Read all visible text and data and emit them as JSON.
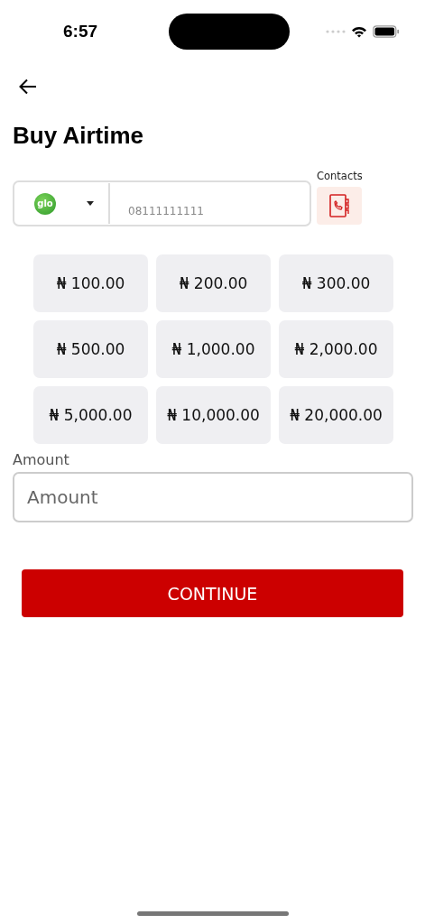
{
  "status_bar": {
    "time": "6:57"
  },
  "title": "Buy Airtime",
  "phone": {
    "network_logo": "glo",
    "placeholder": "08111111111",
    "contacts_label": "Contacts"
  },
  "amount_options": [
    "₦ 100.00",
    "₦ 200.00",
    "₦ 300.00",
    "₦ 500.00",
    "₦ 1,000.00",
    "₦ 2,000.00",
    "₦ 5,000.00",
    "₦ 10,000.00",
    "₦ 20,000.00"
  ],
  "amount": {
    "label": "Amount",
    "placeholder": "Amount"
  },
  "continue_button": "CONTINUE"
}
